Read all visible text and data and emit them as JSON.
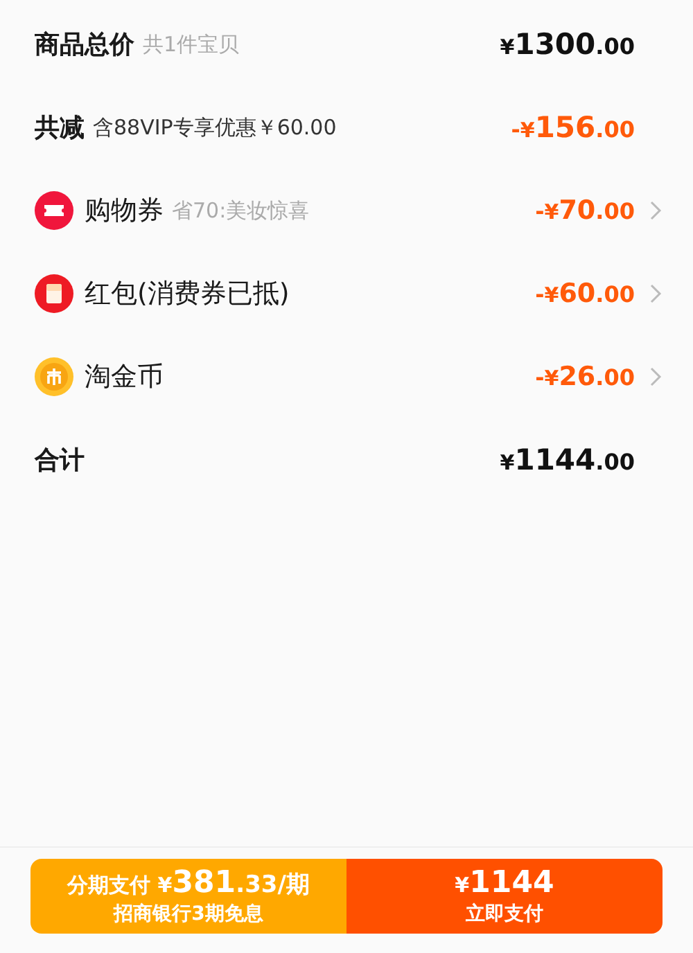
{
  "rows": [
    {
      "kind": "subtotal",
      "label": "商品总价",
      "note": "共1件宝贝",
      "amount": {
        "currency": "¥",
        "integer": "1300",
        "decimal": ".00"
      }
    },
    {
      "kind": "reduction",
      "label": "共减",
      "note": "含88VIP专享优惠￥60.00",
      "amount": {
        "sign": "-",
        "currency": "¥",
        "integer": "156",
        "decimal": ".00"
      }
    },
    {
      "kind": "coupon",
      "label": "购物券",
      "note": "省70:美妆惊喜",
      "amount": {
        "sign": "-",
        "currency": "¥",
        "integer": "70",
        "decimal": ".00"
      }
    },
    {
      "kind": "red_packet",
      "label": "红包(消费券已抵)",
      "amount": {
        "sign": "-",
        "currency": "¥",
        "integer": "60",
        "decimal": ".00"
      }
    },
    {
      "kind": "coin",
      "label": "淘金币",
      "amount": {
        "sign": "-",
        "currency": "¥",
        "integer": "26",
        "decimal": ".00"
      }
    },
    {
      "kind": "total",
      "label": "合计",
      "amount": {
        "currency": "¥",
        "integer": "1144",
        "decimal": ".00"
      }
    }
  ],
  "installment_button": {
    "prefix": "分期支付",
    "currency": "¥",
    "integer": "381",
    "decimal": ".33",
    "suffix": "/期",
    "subtitle": "招商银行3期免息"
  },
  "pay_button": {
    "currency": "¥",
    "integer": "1144",
    "label": "立即支付"
  }
}
